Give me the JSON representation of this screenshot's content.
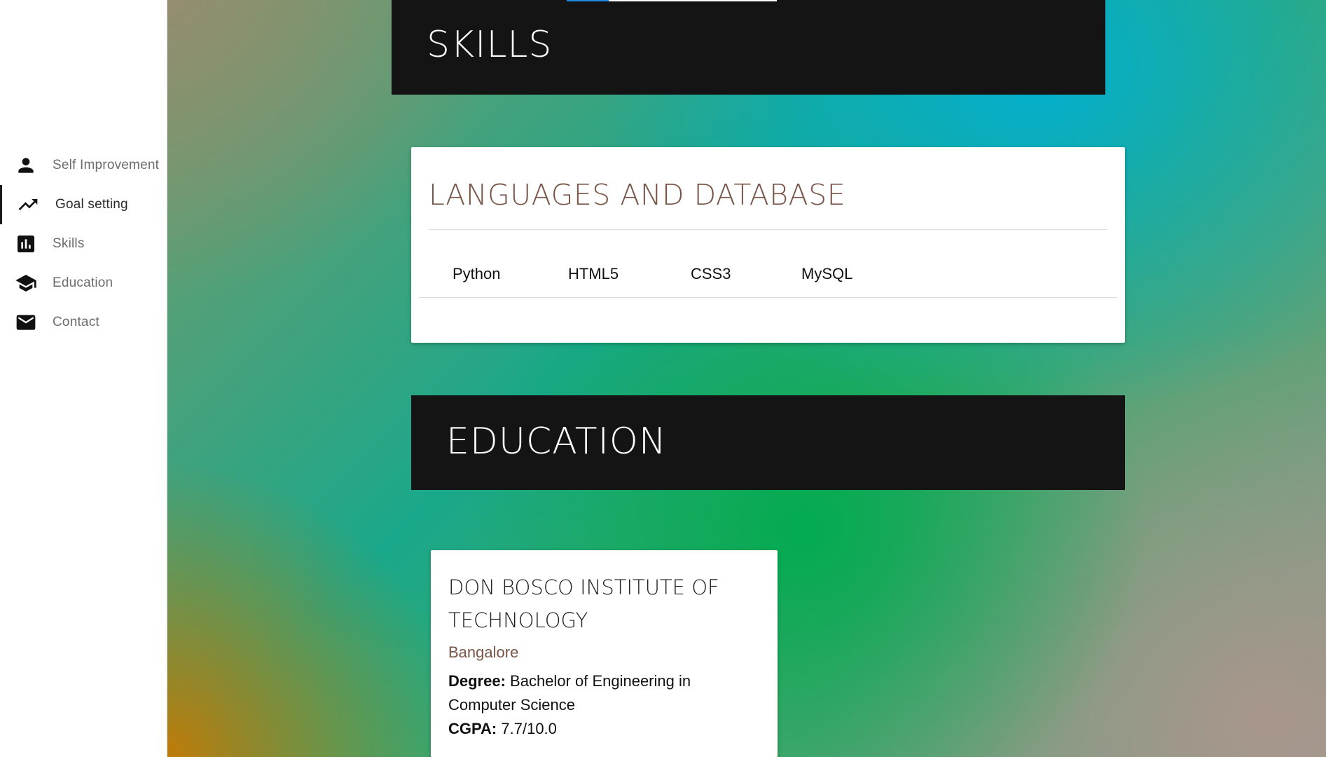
{
  "sidebar": {
    "items": [
      {
        "label": "Self Improvement",
        "icon": "person-icon",
        "active": false
      },
      {
        "label": "Goal setting",
        "icon": "trending-up-icon",
        "active": true
      },
      {
        "label": "Skills",
        "icon": "bar-chart-icon",
        "active": false
      },
      {
        "label": "Education",
        "icon": "school-icon",
        "active": false
      },
      {
        "label": "Contact",
        "icon": "mail-icon",
        "active": false
      }
    ]
  },
  "skills": {
    "section_title": "SKILLS",
    "card": {
      "title": "LANGUAGES AND DATABASE",
      "tags": [
        "Python",
        "HTML5",
        "CSS3",
        "MySQL"
      ]
    }
  },
  "education": {
    "section_title": "EDUCATION",
    "entry": {
      "school": "DON BOSCO INSTITUTE OF TECHNOLOGY",
      "city": "Bangalore",
      "degree_label": "Degree:",
      "degree_value": "Bachelor of Engineering in Computer Science",
      "cgpa_label": "CGPA:",
      "cgpa_value": "7.7/10.0"
    }
  },
  "colors": {
    "sidebar_bg": "#ffffff",
    "section_bar_bg": "#141414",
    "card_title_brown": "#795548",
    "tab_underline_accent": "#1e88e5"
  }
}
